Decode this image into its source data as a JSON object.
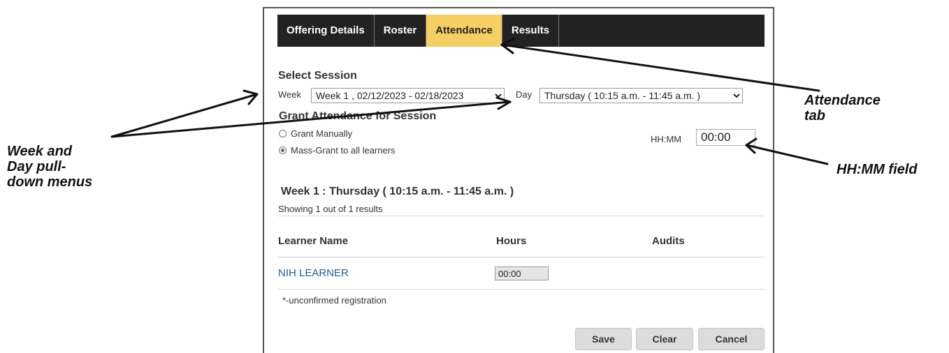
{
  "tabs": [
    "Offering Details",
    "Roster",
    "Attendance",
    "Results"
  ],
  "active_tab": "Attendance",
  "select_session": {
    "title": "Select Session",
    "week_label": "Week",
    "week_value": "Week 1 , 02/12/2023 - 02/18/2023",
    "day_label": "Day",
    "day_value": "Thursday ( 10:15 a.m. - 11:45 a.m. )"
  },
  "grant": {
    "title": "Grant Attendance for Session",
    "options": [
      "Grant Manually",
      "Mass-Grant to all learners"
    ],
    "selected": "Mass-Grant to all learners",
    "hhmm_label": "HH:MM",
    "hhmm_value": "00:00"
  },
  "session_heading": "Week 1 : Thursday ( 10:15 a.m. - 11:45 a.m. )",
  "results_count": "Showing 1 out of 1 results",
  "table": {
    "headers": [
      "Learner Name",
      "Hours",
      "Audits"
    ],
    "rows": [
      {
        "name": "NIH LEARNER",
        "hours": "00:00"
      }
    ]
  },
  "footnote": "*-unconfirmed registration",
  "buttons": {
    "save": "Save",
    "clear": "Clear",
    "cancel": "Cancel"
  },
  "callouts": {
    "attendance": [
      "Attendance",
      "tab"
    ],
    "week_day": [
      "Week and",
      "Day pull-",
      "down menus"
    ],
    "hhmm": "HH:MM field"
  }
}
